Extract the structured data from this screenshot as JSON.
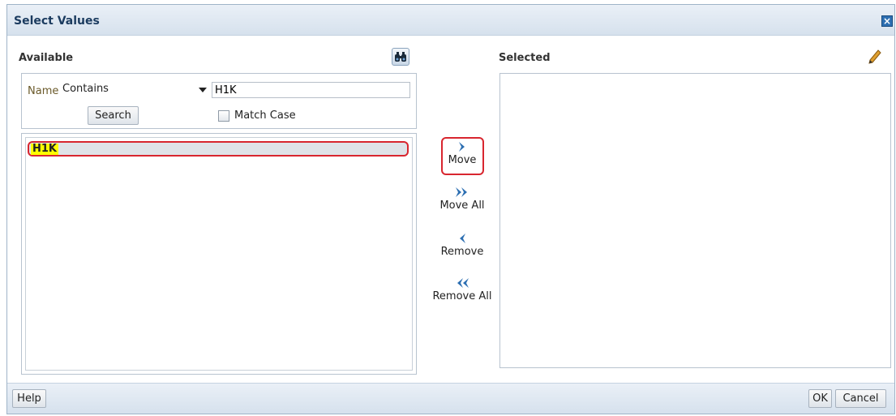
{
  "dialog": {
    "title": "Select Values"
  },
  "available": {
    "label": "Available",
    "name_label": "Name",
    "operator": "Contains",
    "search_value": "H1K",
    "search_button": "Search",
    "match_case_label": "Match Case",
    "items": [
      "H1K"
    ]
  },
  "controls": {
    "move": "Move",
    "move_all": "Move All",
    "remove": "Remove",
    "remove_all": "Remove All"
  },
  "selected": {
    "label": "Selected",
    "items": []
  },
  "footer": {
    "help": "Help",
    "ok": "OK",
    "cancel": "Cancel"
  },
  "icons": {
    "search": "binoculars-icon",
    "edit": "pencil-icon",
    "close": "close-icon",
    "move": "chevron-right-icon",
    "move_all": "double-chevron-right-icon",
    "remove": "chevron-left-icon",
    "remove_all": "double-chevron-left-icon"
  },
  "colors": {
    "highlight": "#ffff00",
    "focus_ring": "#d8262f",
    "accent": "#2d6fb2"
  }
}
